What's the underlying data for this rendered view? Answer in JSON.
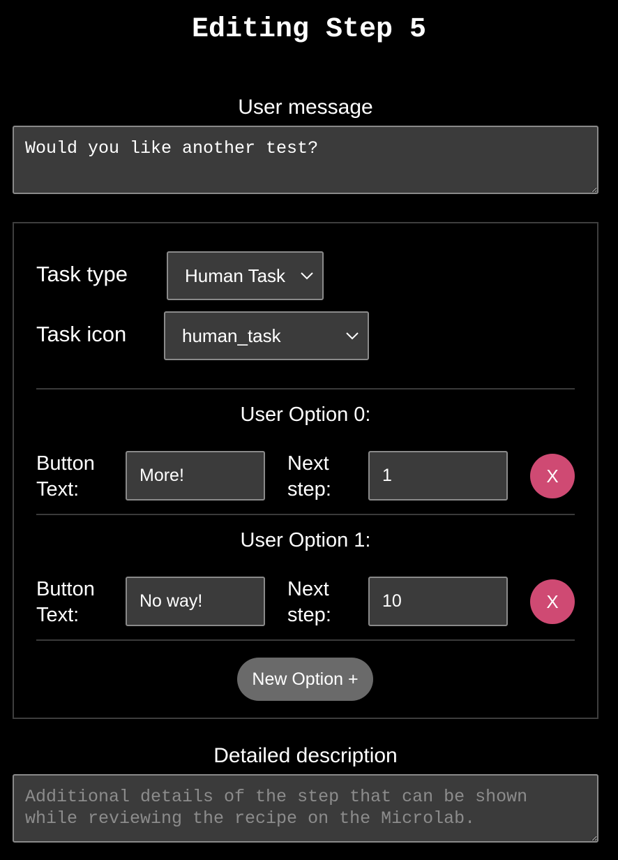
{
  "page": {
    "title": "Editing Step 5"
  },
  "user_message": {
    "label": "User message",
    "value": "Would you like another test?"
  },
  "task": {
    "type_label": "Task type",
    "type_value": "Human Task",
    "icon_label": "Task icon",
    "icon_value": "human_task",
    "chevron_icon": "chevron-down-icon"
  },
  "options": [
    {
      "title": "User Option 0:",
      "button_text_label_1": "Button",
      "button_text_label_2": "Text:",
      "button_text_value": "More!",
      "next_step_label_1": "Next",
      "next_step_label_2": "step:",
      "next_step_value": "1",
      "remove_label": "X"
    },
    {
      "title": "User Option 1:",
      "button_text_label_1": "Button",
      "button_text_label_2": "Text:",
      "button_text_value": "No way!",
      "next_step_label_1": "Next",
      "next_step_label_2": "step:",
      "next_step_value": "10",
      "remove_label": "X"
    }
  ],
  "new_option_label": "New Option +",
  "detailed_description": {
    "label": "Detailed description",
    "placeholder": "Additional details of the step that can be shown while reviewing the recipe on the Microlab."
  },
  "colors": {
    "background": "#000000",
    "field_background": "#3b3b3b",
    "remove_button": "#cf4a73",
    "new_option_button": "#6a6a6a"
  }
}
